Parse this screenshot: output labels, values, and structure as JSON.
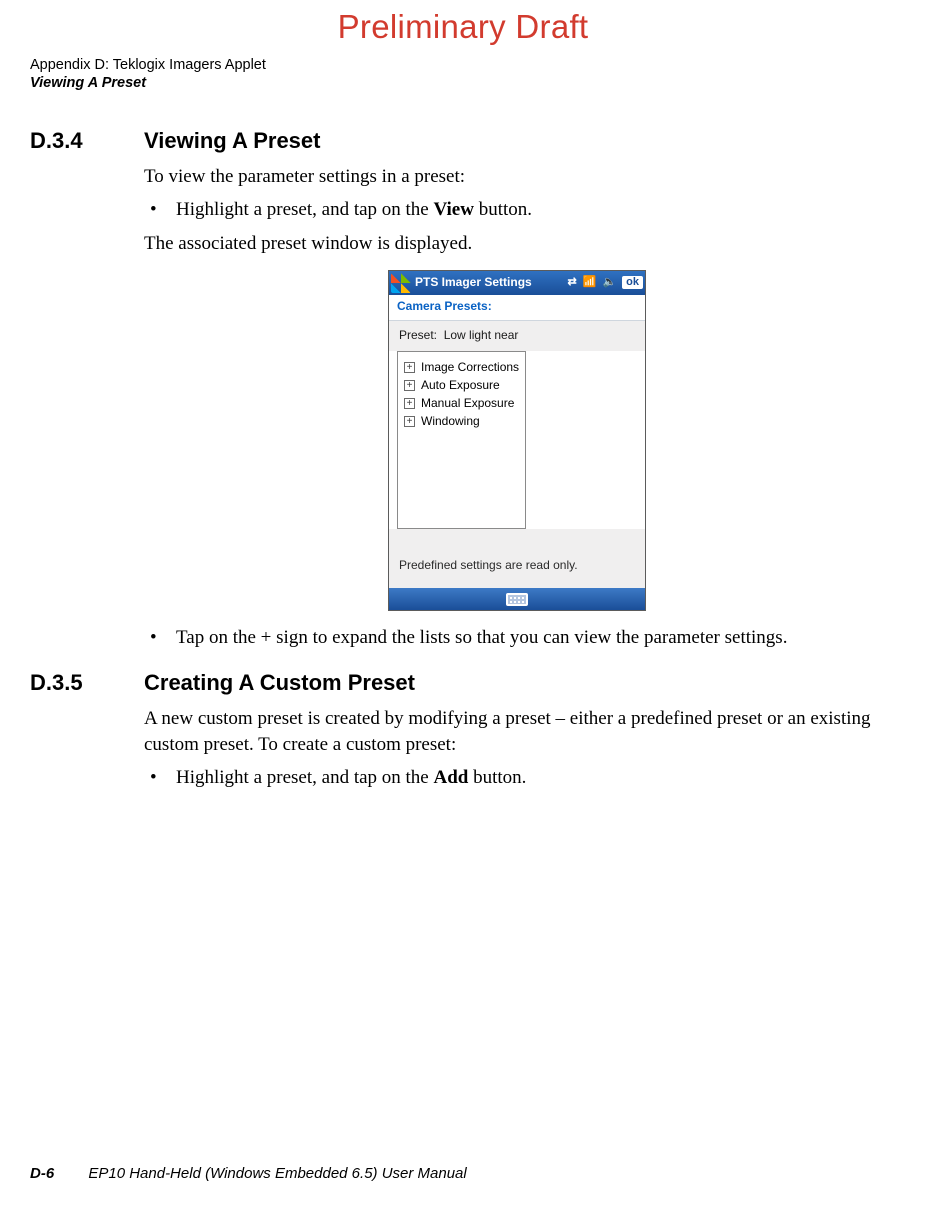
{
  "watermark": "Preliminary Draft",
  "header": {
    "line1": "Appendix D: Teklogix Imagers Applet",
    "line2": "Viewing A Preset"
  },
  "section1": {
    "number": "D.3.4",
    "title": "Viewing A Preset",
    "intro": "To view the parameter settings in a preset:",
    "bullet1_pre": "Highlight a preset, and tap on the ",
    "bullet1_bold": "View",
    "bullet1_post": " button.",
    "after_fig": "The associated preset window is displayed.",
    "bullet2": "Tap on the + sign to expand the lists so that you can view the parameter settings."
  },
  "screenshot": {
    "titlebar": "PTS Imager Settings",
    "ok": "ok",
    "section_label": "Camera Presets:",
    "preset_label": "Preset:",
    "preset_value": "Low light near",
    "tree": [
      "Image Corrections",
      "Auto Exposure",
      "Manual Exposure",
      "Windowing"
    ],
    "status": "Predefined settings are read only."
  },
  "section2": {
    "number": "D.3.5",
    "title": "Creating A Custom Preset",
    "para": "A new custom preset is created by modifying a preset – either a predefined preset or an existing custom preset. To create a custom preset:",
    "bullet1_pre": "Highlight a preset, and tap on the ",
    "bullet1_bold": "Add",
    "bullet1_post": " button."
  },
  "footer": {
    "page_no": "D-6",
    "manual": "EP10 Hand-Held (Windows Embedded 6.5) User Manual"
  }
}
